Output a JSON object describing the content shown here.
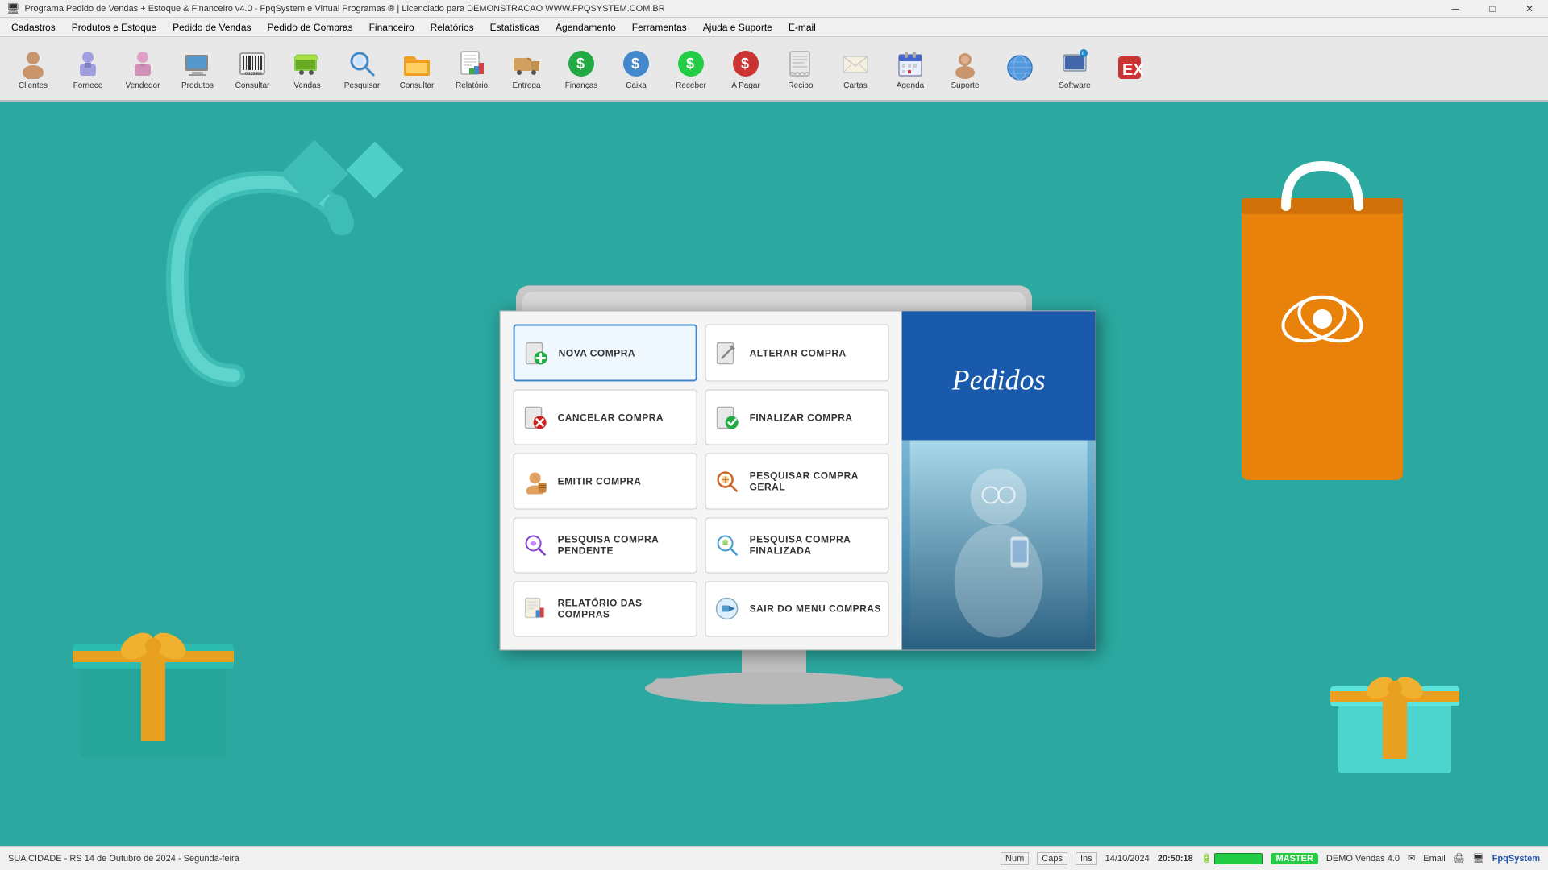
{
  "titlebar": {
    "title": "Programa Pedido de Vendas + Estoque & Financeiro v4.0 - FpqSystem e Virtual Programas ® | Licenciado para  DEMONSTRACAO WWW.FPQSYSTEM.COM.BR",
    "icon": "🖥"
  },
  "menubar": {
    "items": [
      {
        "label": "Cadastros"
      },
      {
        "label": "Produtos e Estoque"
      },
      {
        "label": "Pedido de Vendas"
      },
      {
        "label": "Pedido de Compras"
      },
      {
        "label": "Financeiro"
      },
      {
        "label": "Relatórios"
      },
      {
        "label": "Estatísticas"
      },
      {
        "label": "Agendamento"
      },
      {
        "label": "Ferramentas"
      },
      {
        "label": "Ajuda e Suporte"
      },
      {
        "label": "E-mail"
      }
    ]
  },
  "toolbar": {
    "buttons": [
      {
        "label": "Clientes",
        "icon": "👤"
      },
      {
        "label": "Fornece",
        "icon": "👔"
      },
      {
        "label": "Vendedor",
        "icon": "👩"
      },
      {
        "label": "Produtos",
        "icon": "🖥"
      },
      {
        "label": "Consultar",
        "icon": "🔲"
      },
      {
        "label": "Vendas",
        "icon": "🛒"
      },
      {
        "label": "Pesquisar",
        "icon": "🔍"
      },
      {
        "label": "Consultar",
        "icon": "📂"
      },
      {
        "label": "Relatório",
        "icon": "📊"
      },
      {
        "label": "Entrega",
        "icon": "📦"
      },
      {
        "label": "Finanças",
        "icon": "💰"
      },
      {
        "label": "Caixa",
        "icon": "💵"
      },
      {
        "label": "Receber",
        "icon": "💲"
      },
      {
        "label": "A Pagar",
        "icon": "💸"
      },
      {
        "label": "Recibo",
        "icon": "📋"
      },
      {
        "label": "Cartas",
        "icon": "📧"
      },
      {
        "label": "Agenda",
        "icon": "📅"
      },
      {
        "label": "Suporte",
        "icon": "👩‍💻"
      },
      {
        "label": "",
        "icon": "🌐"
      },
      {
        "label": "Software",
        "icon": "💿"
      },
      {
        "label": "",
        "icon": "🚪"
      }
    ]
  },
  "dialog": {
    "title": "Pedidos",
    "buttons": [
      {
        "id": "nova-compra",
        "label": "NOVA COMPRA",
        "active": true
      },
      {
        "id": "alterar-compra",
        "label": "ALTERAR COMPRA"
      },
      {
        "id": "cancelar-compra",
        "label": "CANCELAR COMPRA"
      },
      {
        "id": "finalizar-compra",
        "label": "FINALIZAR COMPRA"
      },
      {
        "id": "emitir-compra",
        "label": "EMITIR COMPRA"
      },
      {
        "id": "pesquisar-compra-geral",
        "label": "PESQUISAR COMPRA GERAL"
      },
      {
        "id": "pesquisa-compra-pendente",
        "label": "PESQUISA COMPRA PENDENTE"
      },
      {
        "id": "pesquisa-compra-finalizada",
        "label": "PESQUISA COMPRA FINALIZADA"
      },
      {
        "id": "relatorio-compras",
        "label": "RELATÓRIO DAS COMPRAS"
      },
      {
        "id": "sair-menu-compras",
        "label": "SAIR DO MENU COMPRAS"
      }
    ]
  },
  "statusbar": {
    "location": "SUA CIDADE - RS 14 de Outubro de 2024 - Segunda-feira",
    "num": "Num",
    "caps": "Caps",
    "ins": "Ins",
    "date": "14/10/2024",
    "time": "20:50:18",
    "master": "MASTER",
    "demo": "DEMO Vendas 4.0",
    "email": "Email",
    "brand": "FpqSystem"
  }
}
